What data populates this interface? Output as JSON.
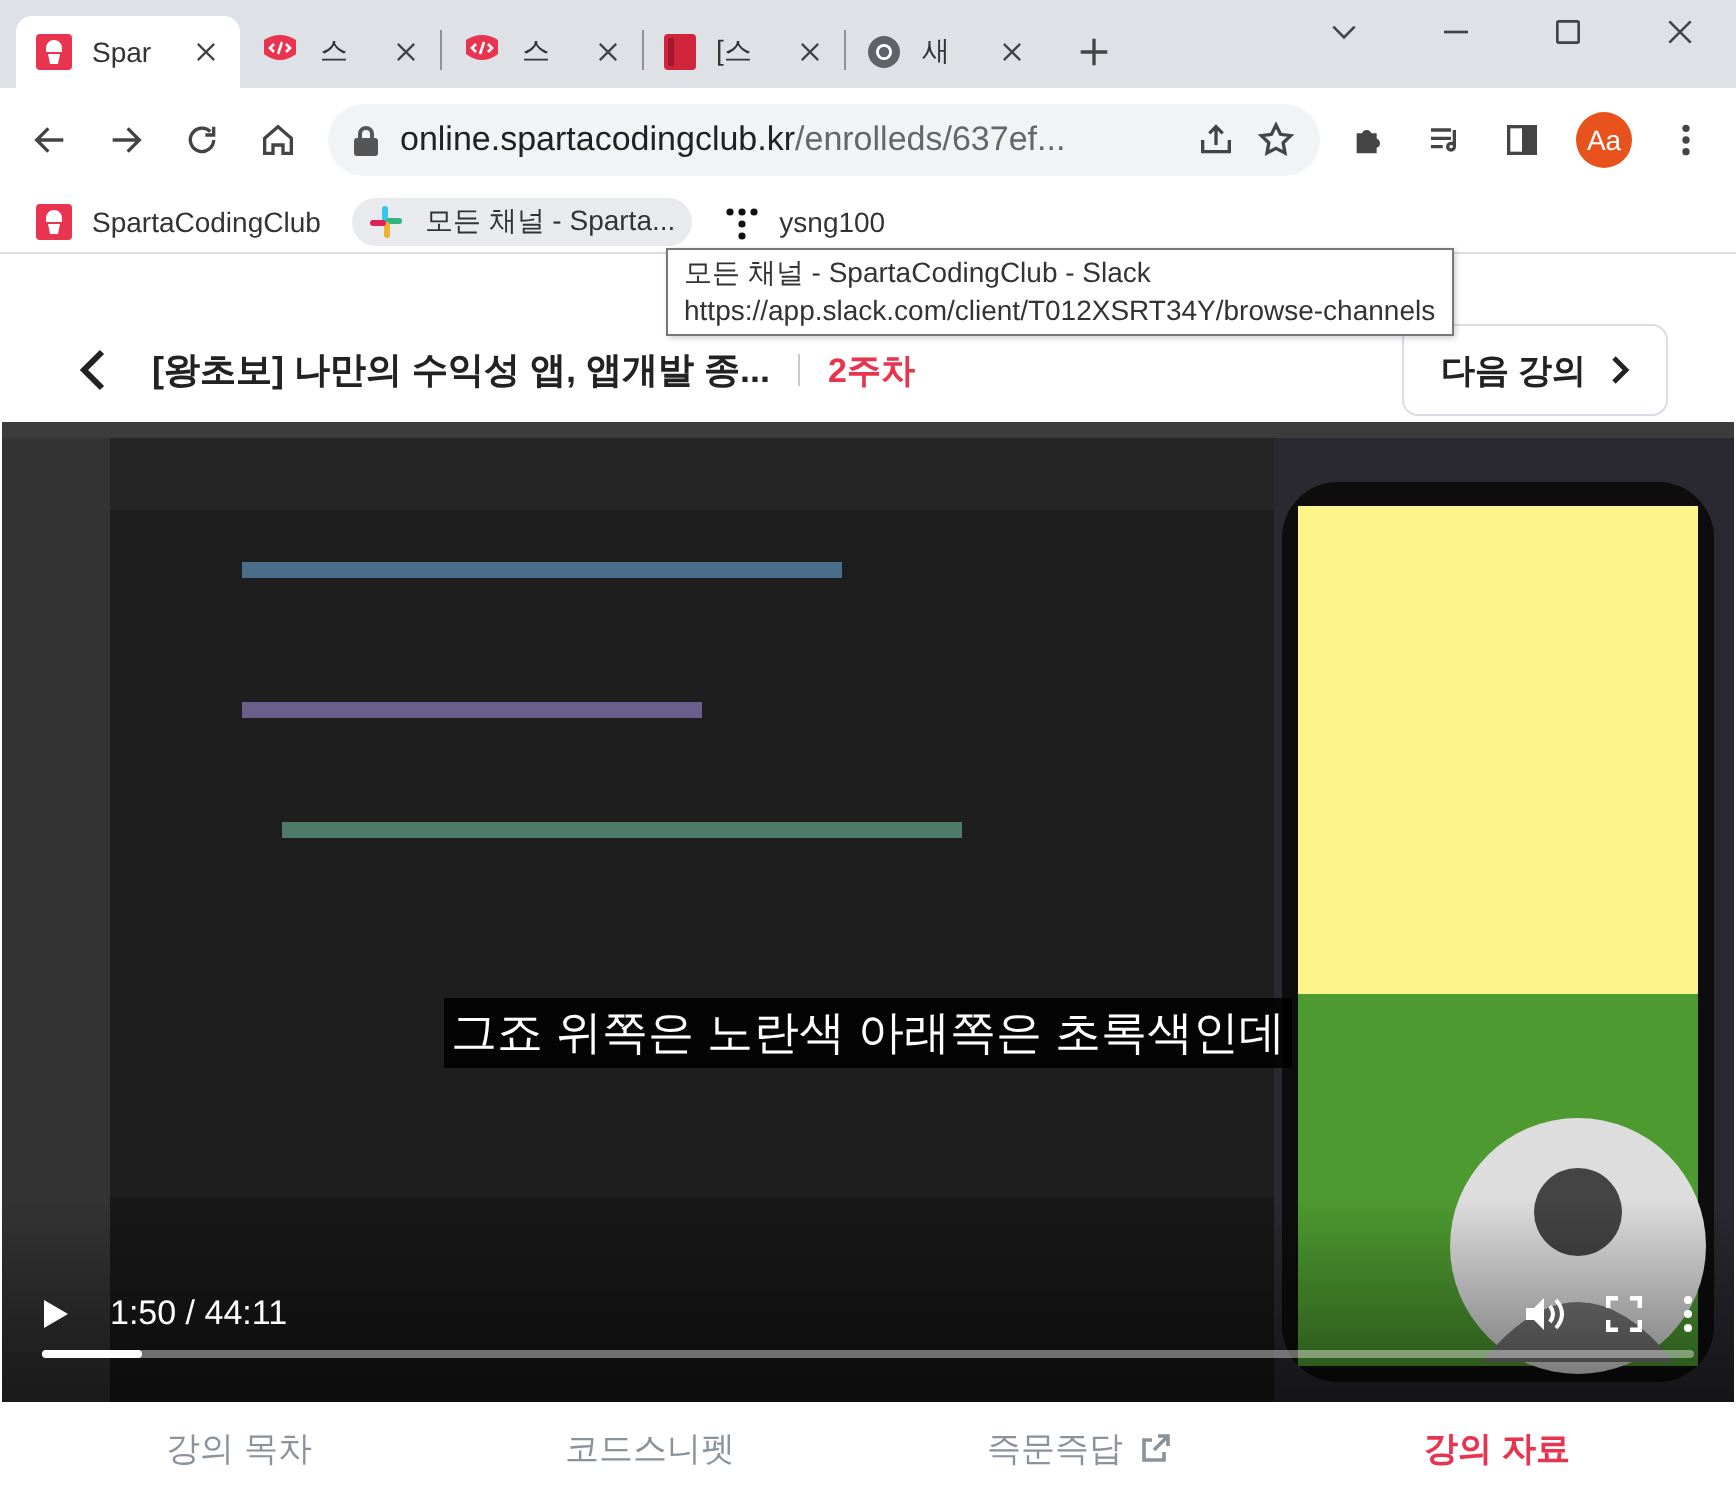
{
  "browser": {
    "tabs": [
      {
        "title": "Spar",
        "kind": "sparta",
        "selected": true
      },
      {
        "title": "스",
        "kind": "code",
        "selected": false
      },
      {
        "title": "스",
        "kind": "code",
        "selected": false
      },
      {
        "title": "[스",
        "kind": "book",
        "selected": false
      },
      {
        "title": "새",
        "kind": "chrome",
        "selected": false
      }
    ],
    "address": {
      "host": "online.spartacodingclub.kr",
      "path": "/enrolleds/637ef..."
    },
    "profile": "Aa",
    "bookmarks": [
      {
        "label": "SpartaCodingClub",
        "kind": "sparta",
        "hovered": false
      },
      {
        "label": "모든 채널 - Sparta...",
        "kind": "slack",
        "hovered": true
      },
      {
        "label": "ysng100",
        "kind": "dots",
        "hovered": false
      }
    ],
    "tooltip": {
      "title": "모든 채널 - SpartaCodingClub - Slack",
      "url": "https://app.slack.com/client/T012XSRT34Y/browse-channels"
    }
  },
  "course": {
    "title": "[왕초보] 나만의 수익성 앱, 앱개발 종...",
    "week": "2주차",
    "next": "다음 강의"
  },
  "video": {
    "kind": "picture",
    "subtitle": "그죠 위쪽은 노란색 아래쪽은 초록색인데",
    "time": "1:50 / 44:11",
    "level": 0.06
  },
  "lecture_tabs": [
    {
      "label": "강의 목차",
      "selected": false,
      "external": false
    },
    {
      "label": "코드스니펫",
      "selected": false,
      "external": false
    },
    {
      "label": "즉문즉답",
      "selected": false,
      "external": true
    },
    {
      "label": "강의 자료",
      "selected": true,
      "external": false
    }
  ]
}
